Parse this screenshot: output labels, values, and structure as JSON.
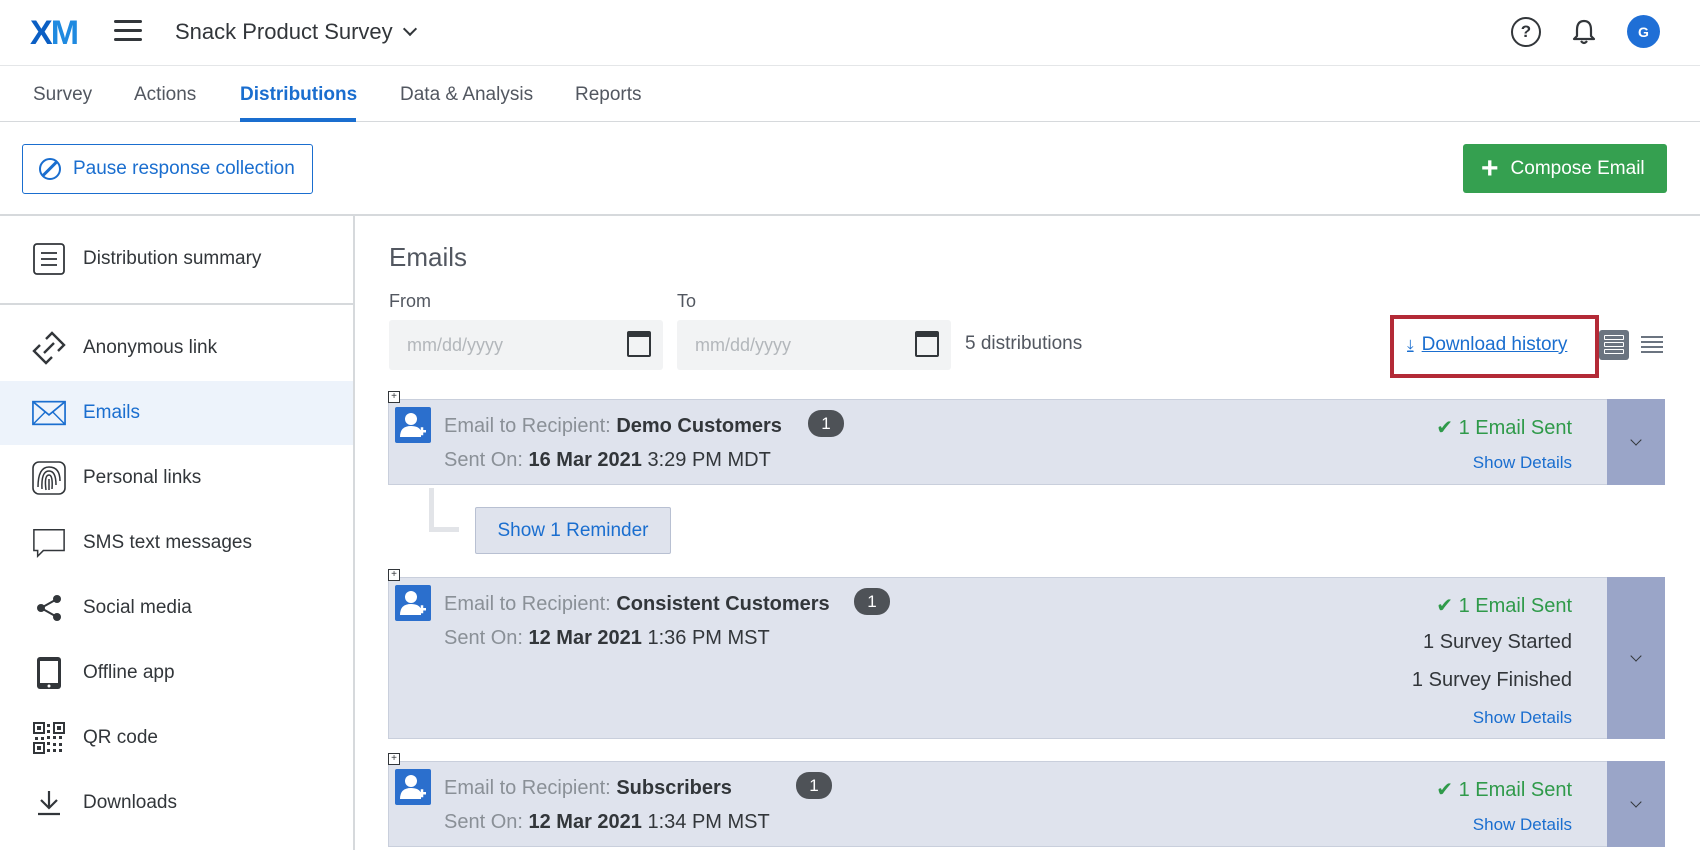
{
  "header": {
    "logo_main": "X",
    "logo_accent": "M",
    "survey_title": "Snack Product Survey",
    "help_icon": "help-circle-icon",
    "help_glyph": "?",
    "notification_icon": "bell-icon",
    "avatar_initial": "G"
  },
  "tabs": [
    {
      "label": "Survey"
    },
    {
      "label": "Actions"
    },
    {
      "label": "Distributions",
      "active": true
    },
    {
      "label": "Data & Analysis"
    },
    {
      "label": "Reports"
    }
  ],
  "actions": {
    "pause_label": "Pause response collection",
    "compose_label": "Compose Email",
    "compose_glyph": "+"
  },
  "sidebar": {
    "items": [
      {
        "label": "Distribution summary",
        "icon": "list-document-icon"
      },
      {
        "label": "Anonymous link",
        "icon": "link-icon"
      },
      {
        "label": "Emails",
        "icon": "envelope-icon",
        "active": true
      },
      {
        "label": "Personal links",
        "icon": "fingerprint-icon"
      },
      {
        "label": "SMS text messages",
        "icon": "chat-bubble-icon"
      },
      {
        "label": "Social media",
        "icon": "share-icon"
      },
      {
        "label": "Offline app",
        "icon": "tablet-icon"
      },
      {
        "label": "QR code",
        "icon": "qr-code-icon"
      },
      {
        "label": "Downloads",
        "icon": "download-icon"
      }
    ]
  },
  "main": {
    "title": "Emails",
    "from_label": "From",
    "to_label": "To",
    "from_placeholder": "mm/dd/yyyy",
    "to_placeholder": "mm/dd/yyyy",
    "distribution_count": "5 distributions",
    "download_history": "Download history",
    "download_glyph": "⤓",
    "reminder_label": "Show 1 Reminder",
    "expand_glyph": "+",
    "email_prefix": "Email to Recipient:",
    "sent_prefix": "Sent On:",
    "show_details": "Show Details"
  },
  "distributions": [
    {
      "recipient": "Demo Customers",
      "count": "1",
      "sent_date": "16 Mar 2021",
      "sent_time": "3:29 PM MDT",
      "status": "✔ 1 Email Sent",
      "stats": []
    },
    {
      "recipient": "Consistent Customers",
      "count": "1",
      "sent_date": "12 Mar 2021",
      "sent_time": "1:36 PM MST",
      "status": "✔ 1 Email Sent",
      "stats": [
        "1 Survey Started",
        "1 Survey Finished"
      ]
    },
    {
      "recipient": "Subscribers",
      "count": "1",
      "sent_date": "12 Mar 2021",
      "sent_time": "1:34 PM MST",
      "status": "✔ 1 Email Sent",
      "stats": []
    }
  ],
  "colors": {
    "accent_blue": "#1a6ecf",
    "compose_green": "#35a050",
    "highlight_red": "#b32a36",
    "card_bg": "#dfe3ed",
    "chevron_bg": "#9aa5c8"
  }
}
